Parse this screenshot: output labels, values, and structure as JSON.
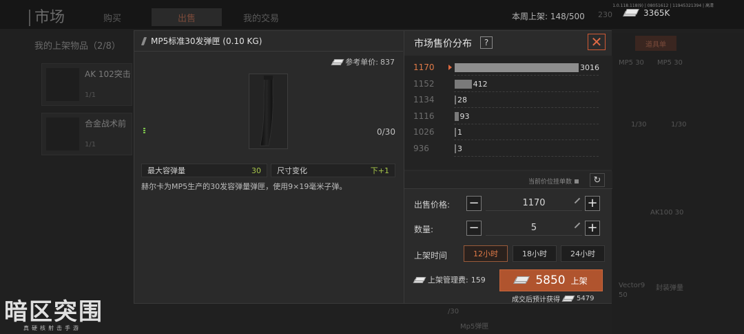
{
  "background": {
    "title": "市场",
    "tabs": [
      "购买",
      "出售",
      "我的交易"
    ],
    "active_tab": 1,
    "version": "1.0.118.118(9) | 08051612 | 11945321394 | 高清",
    "weekly_listed_label": "本周上架:",
    "weekly_listed_value": "148/500",
    "secondary_count": "230",
    "money": "3365K",
    "my_listings": "我的上架物品（2/8）",
    "rows": [
      {
        "name": "AK 102突击",
        "qty": "1/1"
      },
      {
        "name": "合金战术前",
        "qty": "1/1"
      }
    ],
    "right_tab": "道具单",
    "right_labels": [
      "MP5 30",
      "MP5 30",
      "1/30",
      "1/30",
      "AK100 30",
      "Vector9",
      "封装弹量",
      "50",
      "/30",
      "Mp5弹匣"
    ],
    "logo_main": "暗区突围",
    "logo_sub": "真硬核射击手游"
  },
  "item": {
    "title": "MP5标准30发弹匣 (0.10 KG)",
    "ref_price_label": "参考单价:",
    "ref_price": "837",
    "ammo": "0/30",
    "icon": "magazine-icon",
    "stats": [
      {
        "key": "最大容弹量",
        "value": "30"
      },
      {
        "key": "尺寸变化",
        "value": "下+1"
      }
    ],
    "description": "赫尔卡为MP5生产的30发容弹量弹匣，使用9×19毫米子弹。"
  },
  "distribution": {
    "title": "市场售价分布",
    "help": "?",
    "current_price_label": "当前价位挂单数"
  },
  "chart_data": {
    "type": "bar",
    "orientation": "horizontal",
    "categories": [
      "1170",
      "1152",
      "1134",
      "1116",
      "1026",
      "936"
    ],
    "values": [
      3016,
      412,
      28,
      93,
      1,
      3
    ],
    "highlighted_category": "1170",
    "title": "市场售价分布",
    "xlabel": "",
    "ylabel": ""
  },
  "form": {
    "price_label": "出售价格:",
    "price": "1170",
    "qty_label": "数量:",
    "qty": "5",
    "time_label": "上架时间",
    "time_options": [
      "12小时",
      "18小时",
      "24小时"
    ],
    "selected_time": 0,
    "fee_label": "上架管理费:",
    "fee": "159",
    "list_amount": "5850",
    "list_label": "上架",
    "expected_label": "成交后预计获得",
    "expected": "5479"
  },
  "colors": {
    "accent": "#b0542e",
    "highlight": "#e07a48",
    "stat_value": "#a7c64a"
  }
}
